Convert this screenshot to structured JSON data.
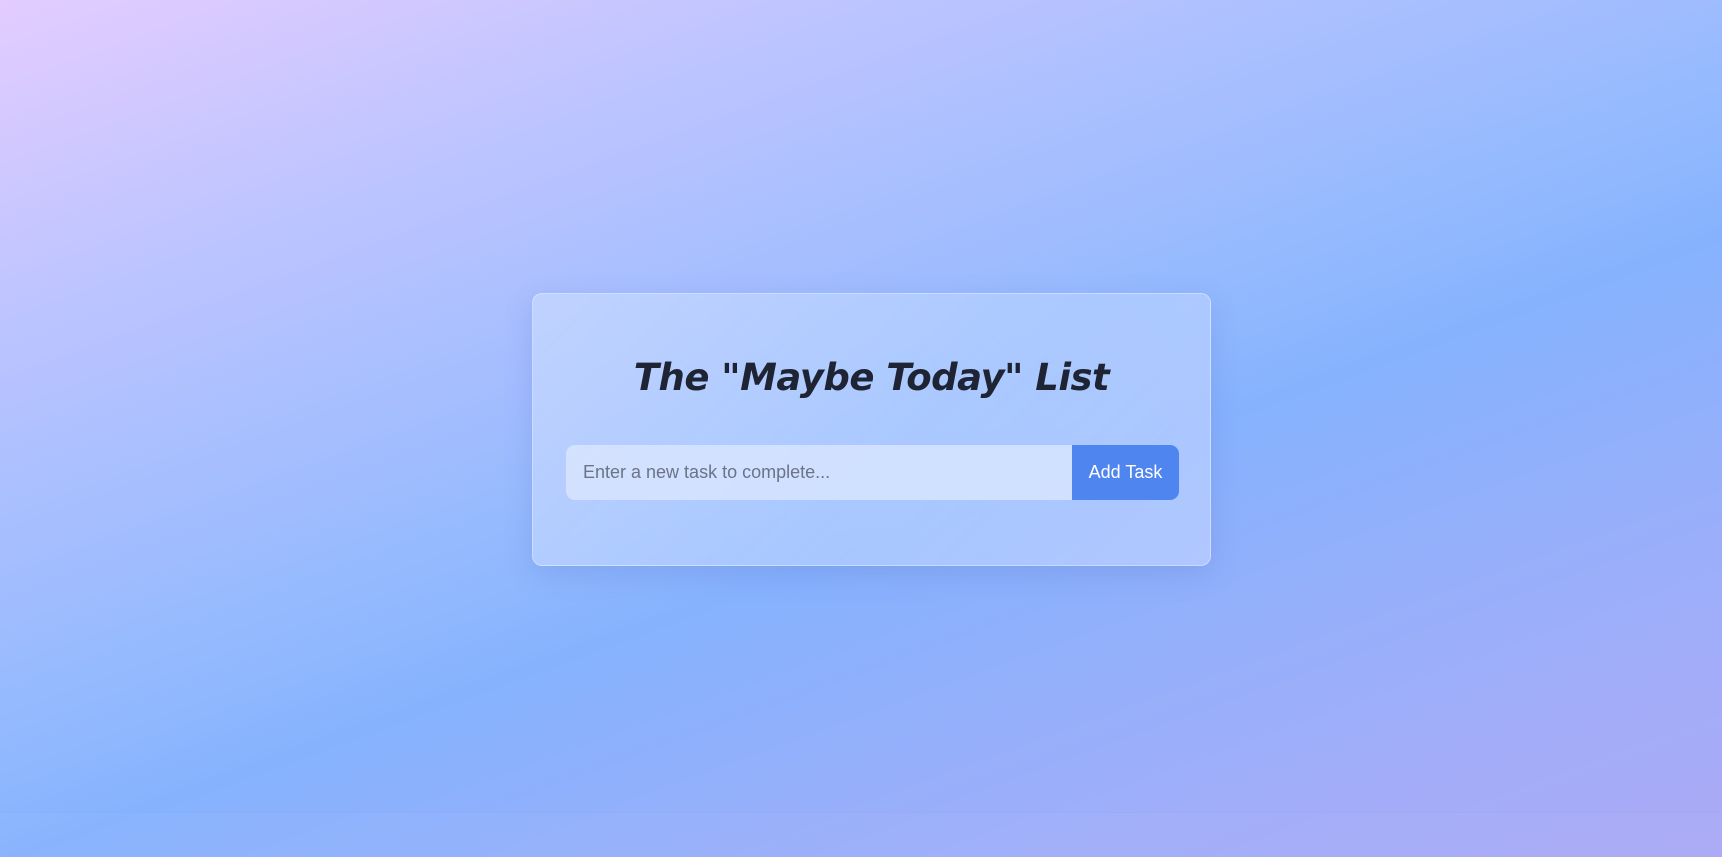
{
  "todo": {
    "title": "The \"Maybe Today\" List",
    "input": {
      "value": "",
      "placeholder": "Enter a new task to complete..."
    },
    "add_button_label": "Add Task",
    "tasks": []
  },
  "colors": {
    "accent": "#4f85ef",
    "title_text": "#1e2433",
    "background_gradient": [
      "#e3ccff",
      "#86b2fd",
      "#aba9f5"
    ]
  }
}
